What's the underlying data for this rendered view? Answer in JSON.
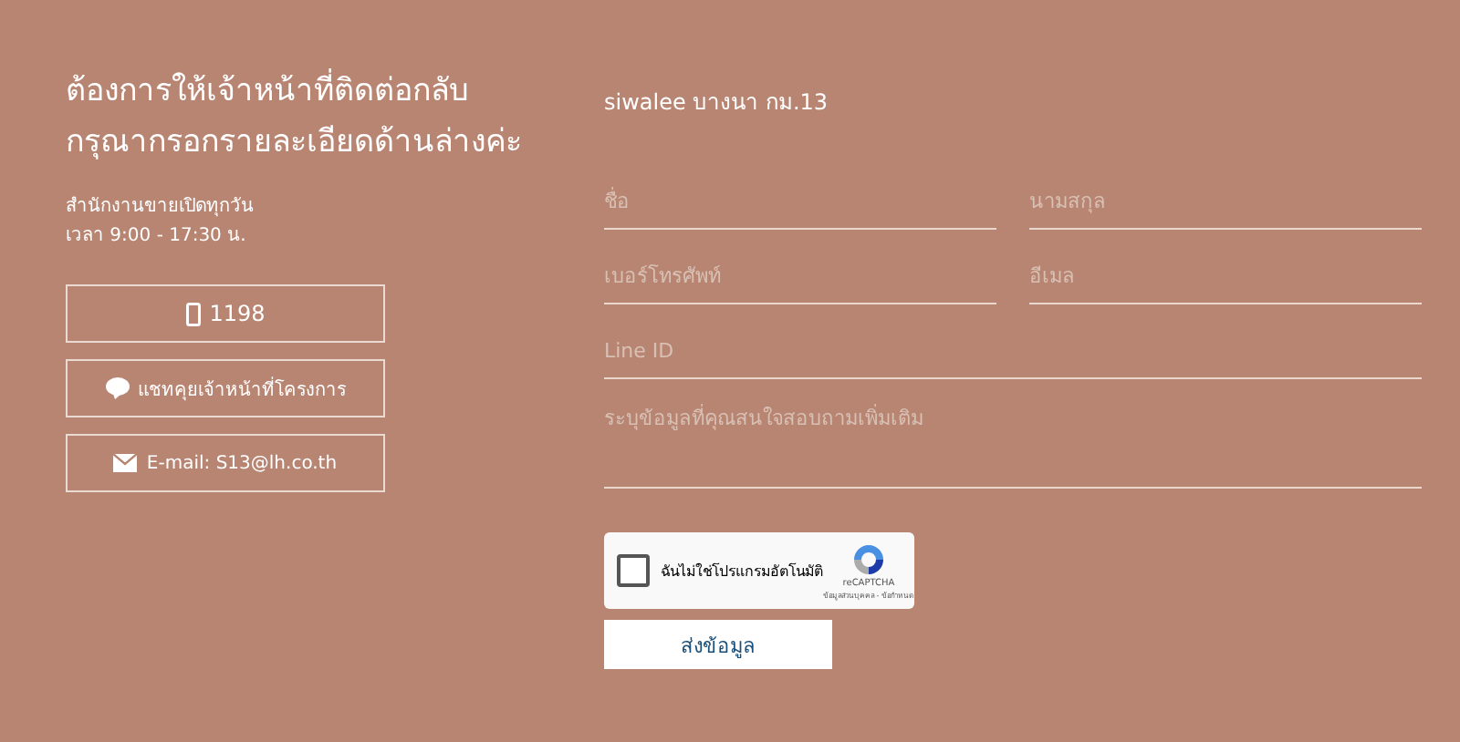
{
  "heading": [
    "ต้องการให้เจ้าหน้าที่ติดต่อกลับ",
    "กรุณากรอกรายละเอียดด้านล่างค่ะ"
  ],
  "hours": [
    "สำนักงานขายเปิดทุกวัน",
    "เวลา 9:00 - 17:30 น."
  ],
  "contact_buttons": [
    {
      "kind": "phone",
      "label": "1198"
    },
    {
      "kind": "line",
      "label": "แชทคุยเจ้าหน้าที่โครงการ"
    },
    {
      "kind": "email",
      "label": "E-mail: S13@lh.co.th"
    }
  ],
  "project_name": "siwalee บางนา กม.13",
  "form": {
    "rows": [
      [
        {
          "placeholder": "ชื่อ"
        },
        {
          "placeholder": "นามสกุล"
        }
      ],
      [
        {
          "placeholder": "เบอร์โทรศัพท์"
        },
        {
          "placeholder": "อีเมล"
        }
      ],
      [
        {
          "placeholder": "Line ID"
        }
      ]
    ],
    "message": {
      "placeholder": "ระบุข้อมูลที่คุณสนใจสอบถามเพิ่มเติม"
    },
    "captcha": {
      "label": "ฉันไม่ใช่โปรแกรมอัตโนมัติ",
      "checked": false,
      "brand": "reCAPTCHA",
      "links": "ข้อมูลส่วนบุคคล - ข้อกำหนด"
    },
    "submit": "ส่งข้อมูล"
  }
}
